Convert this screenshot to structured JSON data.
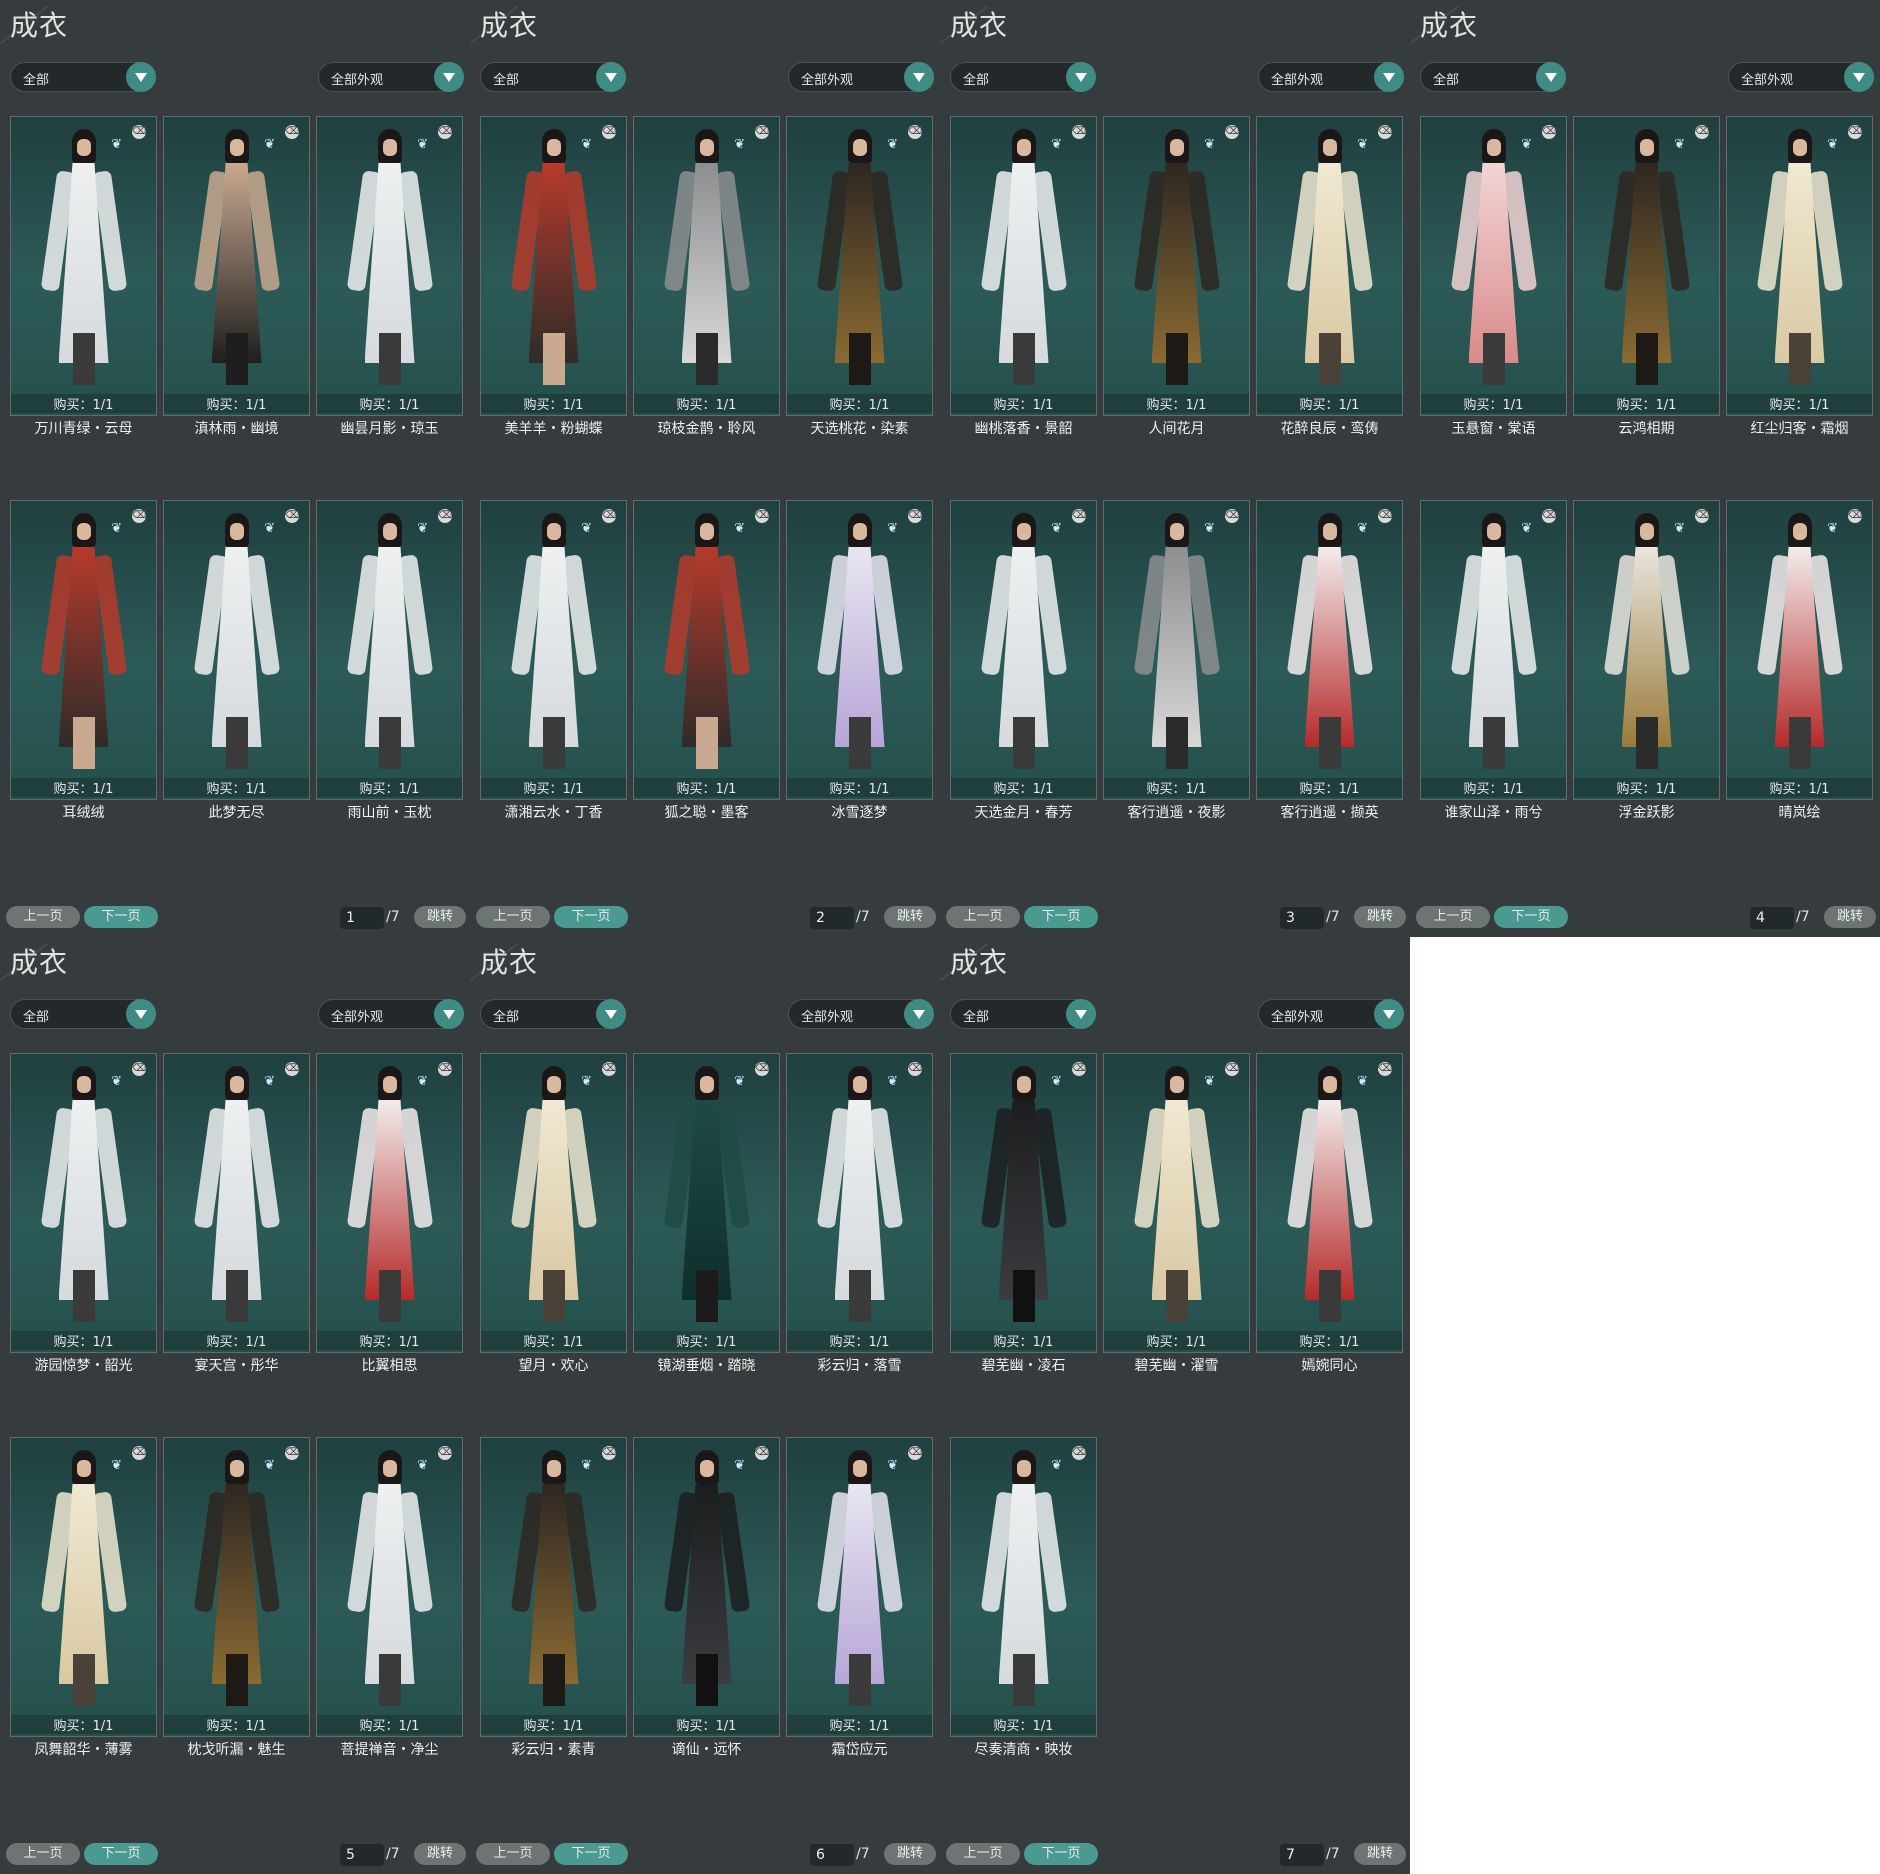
{
  "panels": [
    {
      "title": "成衣",
      "filter": "全部",
      "look": "全部外观",
      "cards": [
        {
          "name": "万川青绿・云母",
          "buy": "购买：1/1",
          "palette": "white"
        },
        {
          "name": "滇林雨・幽境",
          "buy": "购买：1/1",
          "palette": "bare"
        },
        {
          "name": "幽昙月影・琼玉",
          "buy": "购买：1/1",
          "palette": "white"
        },
        {
          "name": "耳绒绒",
          "buy": "购买：1/1",
          "palette": "redpants"
        },
        {
          "name": "此梦无尽",
          "buy": "购买：1/1",
          "palette": "white"
        },
        {
          "name": "雨山前・玉枕",
          "buy": "购买：1/1",
          "palette": "white"
        }
      ],
      "prev": "上一页",
      "next": "下一页",
      "page": "1",
      "total": "/7",
      "jump": "跳转"
    },
    {
      "title": "成衣",
      "filter": "全部",
      "look": "全部外观",
      "cards": [
        {
          "name": "美羊羊・粉蝴蝶",
          "buy": "购买：1/1",
          "palette": "redpants"
        },
        {
          "name": "琼枝金鹊・聆风",
          "buy": "购买：1/1",
          "palette": "grey"
        },
        {
          "name": "天选桃花・染素",
          "buy": "购买：1/1",
          "palette": "dark"
        },
        {
          "name": "潇湘云水・丁香",
          "buy": "购买：1/1",
          "palette": "white"
        },
        {
          "name": "狐之聪・墨客",
          "buy": "购买：1/1",
          "palette": "redpants"
        },
        {
          "name": "冰雪逐梦",
          "buy": "购买：1/1",
          "palette": "lavender"
        }
      ],
      "prev": "上一页",
      "next": "下一页",
      "page": "2",
      "total": "/7",
      "jump": "跳转"
    },
    {
      "title": "成衣",
      "filter": "全部",
      "look": "全部外观",
      "cards": [
        {
          "name": "幽桃落香・景韶",
          "buy": "购买：1/1",
          "palette": "white"
        },
        {
          "name": "人间花月",
          "buy": "购买：1/1",
          "palette": "dark"
        },
        {
          "name": "花醉良辰・鸾俦",
          "buy": "购买：1/1",
          "palette": "cream"
        },
        {
          "name": "天选金月・春芳",
          "buy": "购买：1/1",
          "palette": "white"
        },
        {
          "name": "客行逍遥・夜影",
          "buy": "购买：1/1",
          "palette": "grey"
        },
        {
          "name": "客行逍遥・撷英",
          "buy": "购买：1/1",
          "palette": "red"
        }
      ],
      "prev": "上一页",
      "next": "下一页",
      "page": "3",
      "total": "/7",
      "jump": "跳转"
    },
    {
      "title": "成衣",
      "filter": "全部",
      "look": "全部外观",
      "cards": [
        {
          "name": "玉悬窗・棠语",
          "buy": "购买：1/1",
          "palette": "pink"
        },
        {
          "name": "云鸿相期",
          "buy": "购买：1/1",
          "palette": "dark"
        },
        {
          "name": "红尘归客・霜烟",
          "buy": "购买：1/1",
          "palette": "cream"
        },
        {
          "name": "谁家山泽・雨兮",
          "buy": "购买：1/1",
          "palette": "white"
        },
        {
          "name": "浮金跃影",
          "buy": "购买：1/1",
          "palette": "gold"
        },
        {
          "name": "晴岚绘",
          "buy": "购买：1/1",
          "palette": "red"
        }
      ],
      "prev": "上一页",
      "next": "下一页",
      "page": "4",
      "total": "/7",
      "jump": "跳转"
    },
    {
      "title": "成衣",
      "filter": "全部",
      "look": "全部外观",
      "cards": [
        {
          "name": "游园惊梦・韶光",
          "buy": "购买：1/1",
          "palette": "white"
        },
        {
          "name": "宴天宫・彤华",
          "buy": "购买：1/1",
          "palette": "white"
        },
        {
          "name": "比翼相思",
          "buy": "购买：1/1",
          "palette": "red"
        },
        {
          "name": "凤舞韶华・薄雾",
          "buy": "购买：1/1",
          "palette": "cream"
        },
        {
          "name": "枕戈听漏・魅生",
          "buy": "购买：1/1",
          "palette": "dark"
        },
        {
          "name": "菩提禅音・净尘",
          "buy": "购买：1/1",
          "palette": "white"
        }
      ],
      "prev": "上一页",
      "next": "下一页",
      "page": "5",
      "total": "/7",
      "jump": "跳转"
    },
    {
      "title": "成衣",
      "filter": "全部",
      "look": "全部外观",
      "cards": [
        {
          "name": "望月・欢心",
          "buy": "购买：1/1",
          "palette": "cream"
        },
        {
          "name": "镜湖垂烟・踏晓",
          "buy": "购买：1/1",
          "palette": "green"
        },
        {
          "name": "彩云归・落雪",
          "buy": "购买：1/1",
          "palette": "white"
        },
        {
          "name": "彩云归・素青",
          "buy": "购买：1/1",
          "palette": "dark"
        },
        {
          "name": "谪仙・远怀",
          "buy": "购买：1/1",
          "palette": "black"
        },
        {
          "name": "霜岱应元",
          "buy": "购买：1/1",
          "palette": "lavender"
        }
      ],
      "prev": "上一页",
      "next": "下一页",
      "page": "6",
      "total": "/7",
      "jump": "跳转"
    },
    {
      "title": "成衣",
      "filter": "全部",
      "look": "全部外观",
      "cards": [
        {
          "name": "碧芜幽・凌石",
          "buy": "购买：1/1",
          "palette": "black"
        },
        {
          "name": "碧芜幽・濯雪",
          "buy": "购买：1/1",
          "palette": "cream"
        },
        {
          "name": "嫣婉同心",
          "buy": "购买：1/1",
          "palette": "red"
        },
        {
          "name": "尽奏清商・映妆",
          "buy": "购买：1/1",
          "palette": "white"
        }
      ],
      "prev": "上一页",
      "next": "下一页",
      "page": "7",
      "total": "/7",
      "jump": "跳转"
    }
  ],
  "colors": {
    "panel_bg": "#363c3d",
    "card_bg": "#244a48",
    "accent": "#4b9a92"
  },
  "palettes": {
    "white": [
      "#eef0f1",
      "#d5dadd",
      "#3a3a3a"
    ],
    "cream": [
      "#f0e8d2",
      "#d9c9a3",
      "#4a4238"
    ],
    "bare": [
      "#c9a98f",
      "#1e1e1e",
      "#1e1e1e"
    ],
    "redpants": [
      "#b63a2a",
      "#2e2b29",
      "#c9a98f"
    ],
    "grey": [
      "#8d8e90",
      "#d8d8d8",
      "#2b2b2b"
    ],
    "dark": [
      "#2e2721",
      "#8a6a32",
      "#1d1a16"
    ],
    "lavender": [
      "#e8e6f1",
      "#b7a6d6",
      "#3a3a3a"
    ],
    "red": [
      "#f3ecec",
      "#b52a2a",
      "#3a3a3a"
    ],
    "pink": [
      "#f2d5d5",
      "#d98a8a",
      "#3a3a3a"
    ],
    "gold": [
      "#e9e6de",
      "#9a7a3a",
      "#2b2b2b"
    ],
    "green": [
      "#1f4a44",
      "#0f2f2c",
      "#1b1b1b"
    ],
    "black": [
      "#1c1d1f",
      "#3b3c3f",
      "#111111"
    ]
  }
}
